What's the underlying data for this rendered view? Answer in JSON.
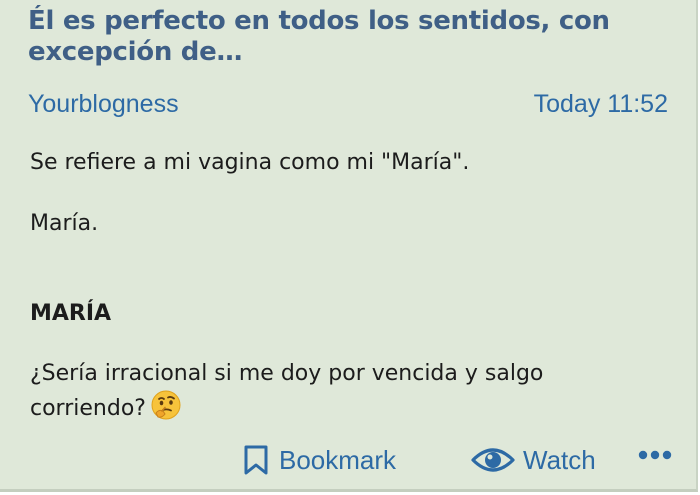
{
  "post": {
    "title": "Él es perfecto en todos los sentidos, con excepción de…",
    "author": "Yourblogness",
    "timestamp": "Today 11:52",
    "paragraphs": [
      "Se refiere a mi vagina como mi \"María\".",
      "María.",
      "MARÍA",
      "¿Sería irracional si me doy por vencida y salgo corriendo?"
    ]
  },
  "actions": {
    "bookmark_label": "Bookmark",
    "watch_label": "Watch",
    "bookmark_icon": "bookmark-icon",
    "watch_icon": "eye-icon",
    "more_icon": "more-dots-icon"
  },
  "colors": {
    "card_background": "#dfe8d9",
    "title": "#3f5f86",
    "link": "#2d6aa5",
    "text": "#1c1c1c"
  }
}
